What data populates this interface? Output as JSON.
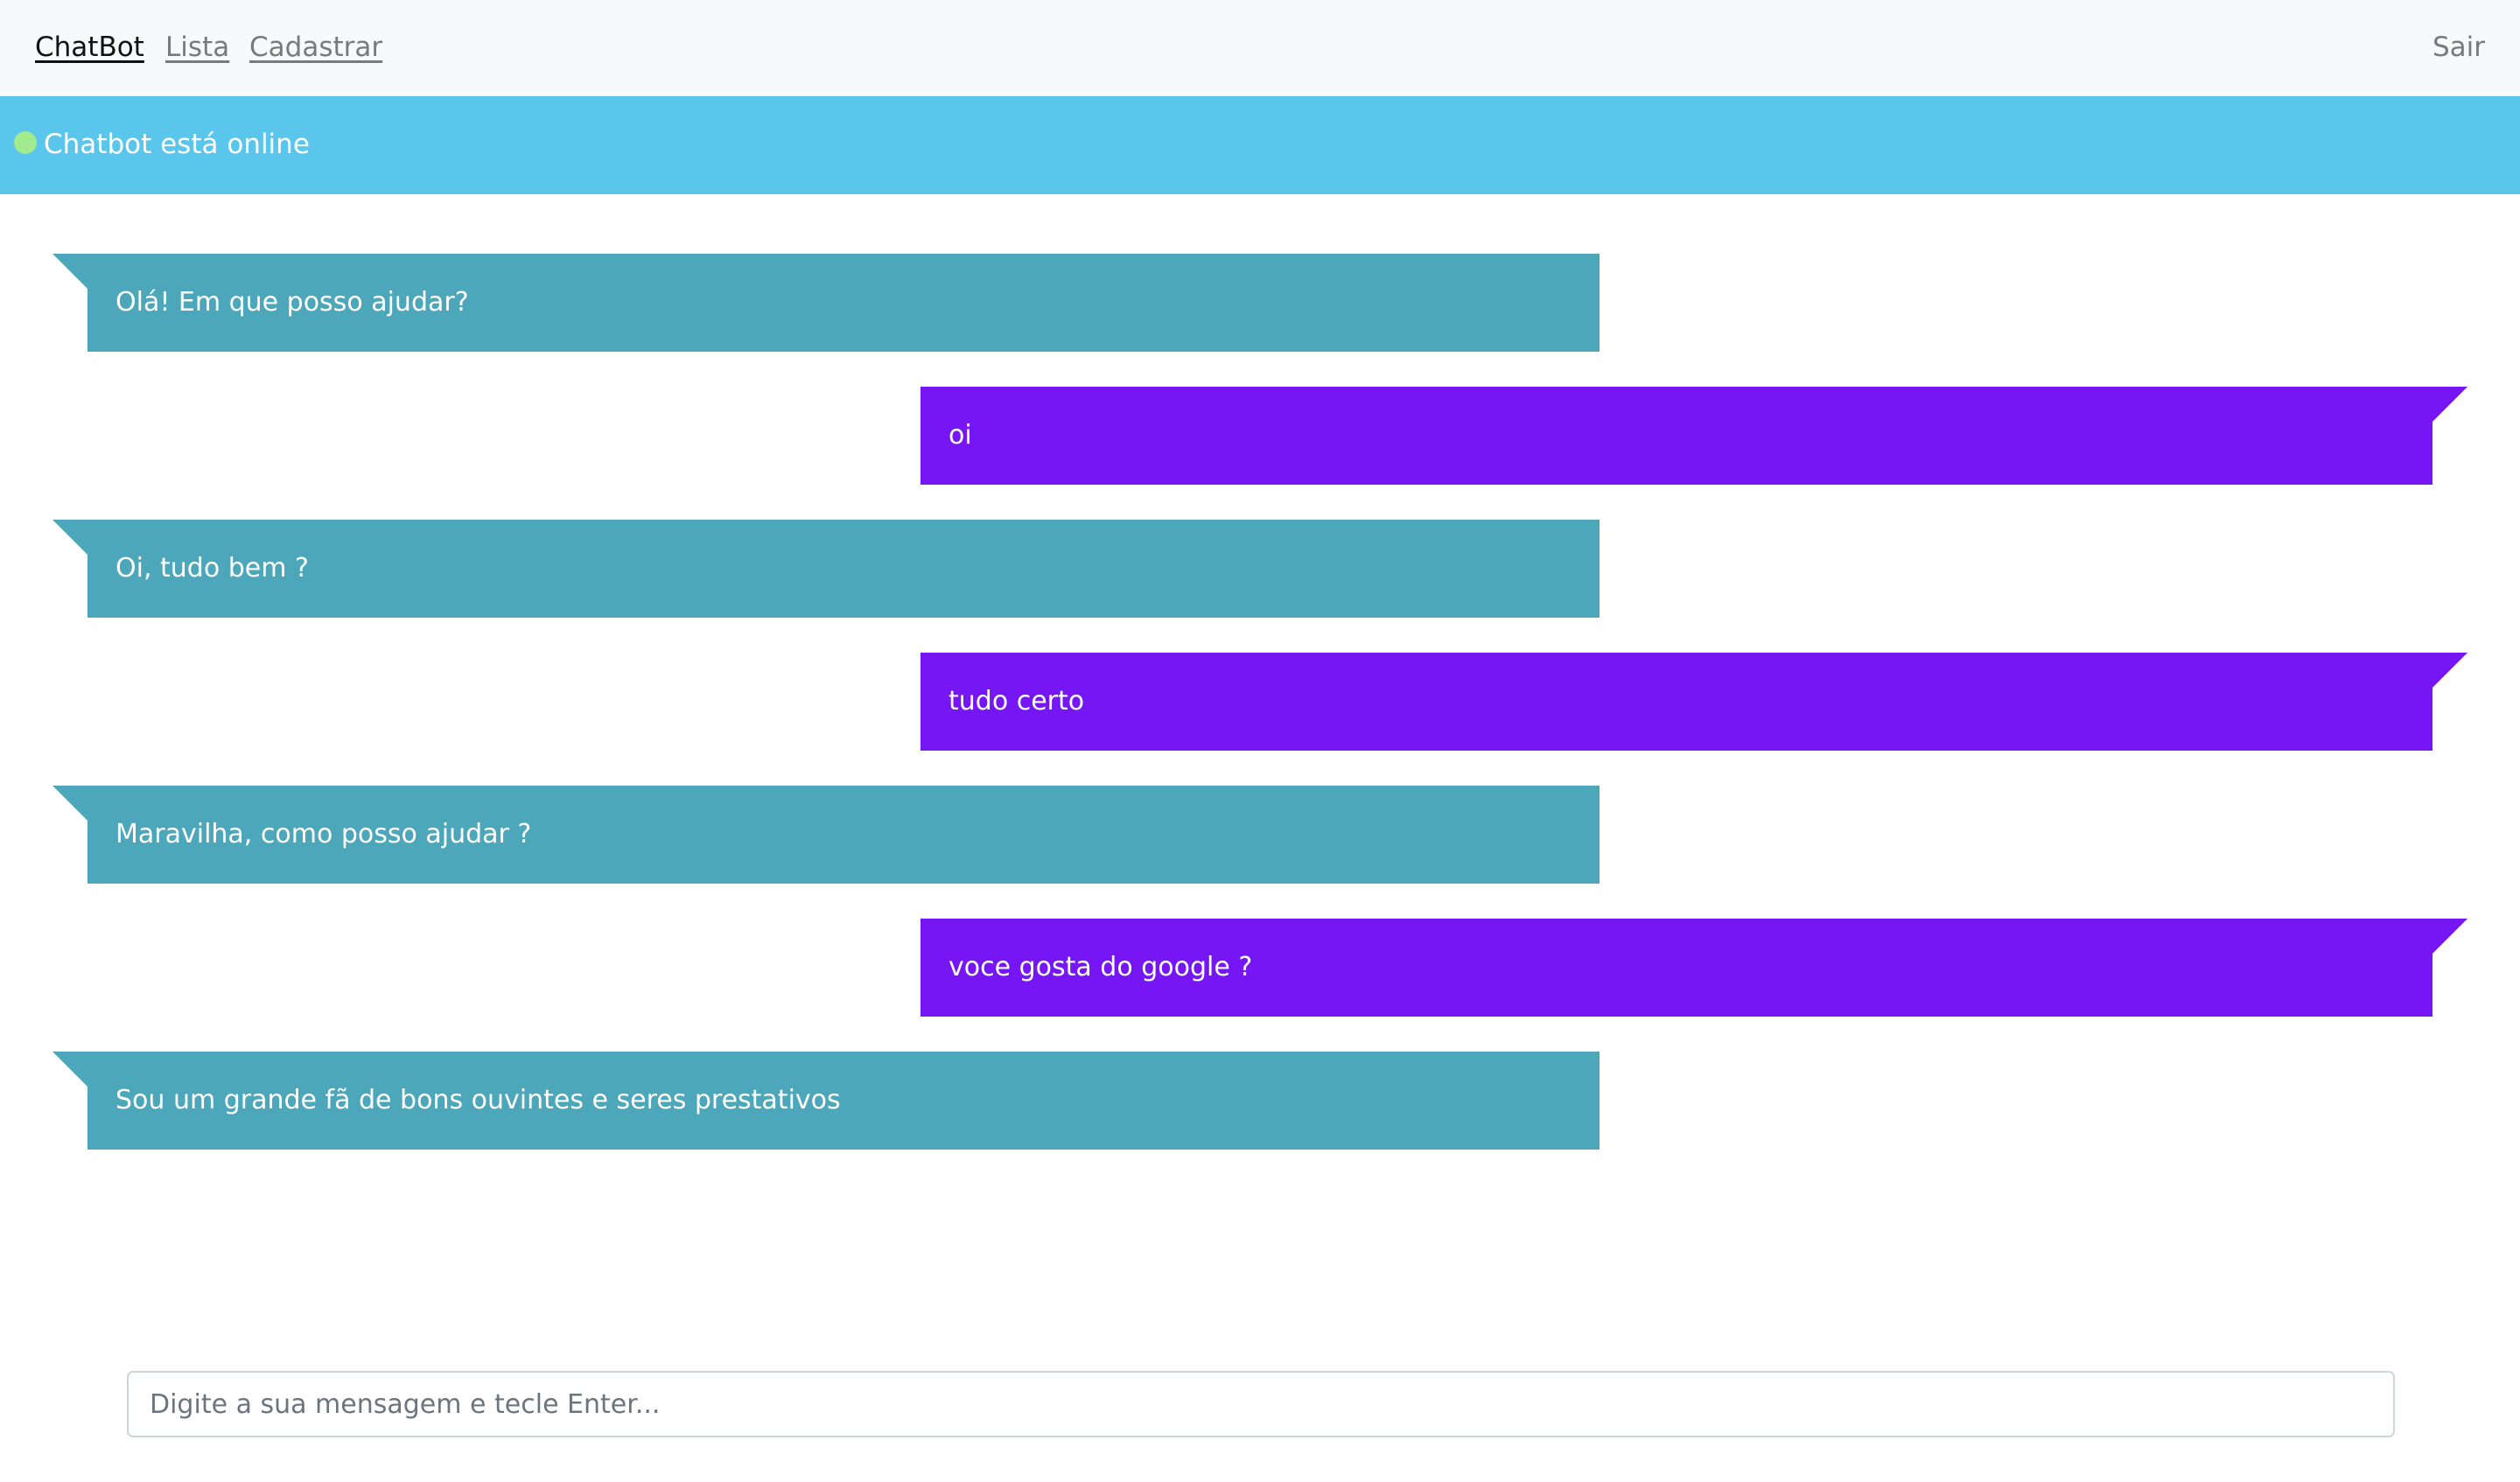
{
  "nav": {
    "brand": "ChatBot",
    "links": [
      "Lista",
      "Cadastrar"
    ],
    "logout": "Sair"
  },
  "status": {
    "text": "Chatbot está online",
    "dot_color": "#a2ea8e",
    "bar_color": "#5bc6ec"
  },
  "messages": [
    {
      "sender": "bot",
      "text": "Olá! Em que posso ajudar?"
    },
    {
      "sender": "user",
      "text": "oi"
    },
    {
      "sender": "bot",
      "text": "Oi, tudo bem ?"
    },
    {
      "sender": "user",
      "text": "tudo certo"
    },
    {
      "sender": "bot",
      "text": "Maravilha, como posso ajudar ?"
    },
    {
      "sender": "user",
      "text": "voce gosta do google ?"
    },
    {
      "sender": "bot",
      "text": "Sou um grande fã de bons ouvintes e seres prestativos"
    }
  ],
  "colors": {
    "bot_bubble": "#4ba7b9",
    "user_bubble": "#7616f5"
  },
  "input": {
    "value": "",
    "placeholder": "Digite a sua mensagem e tecle Enter..."
  }
}
